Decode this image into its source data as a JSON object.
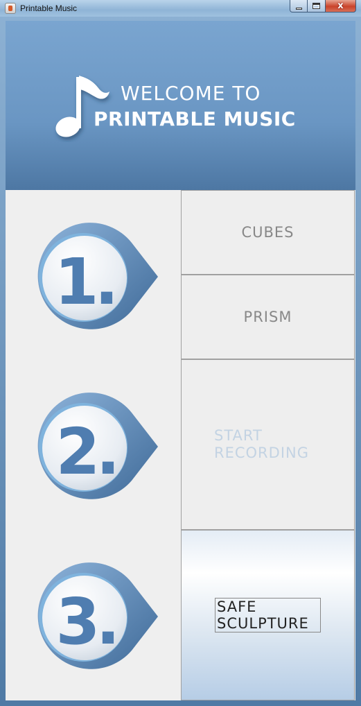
{
  "window": {
    "title": "Printable Music",
    "close_glyph": "x"
  },
  "banner": {
    "line1": "WELCOME TO",
    "line2": "PRINTABLE MUSIC",
    "logo_icon": "music-note-icon"
  },
  "steps": [
    {
      "number": "1.",
      "icon": "step-one-badge-icon"
    },
    {
      "number": "2.",
      "icon": "step-two-badge-icon"
    },
    {
      "number": "3.",
      "icon": "step-three-badge-icon"
    }
  ],
  "buttons": {
    "cubes": "CUBES",
    "prism": "PRISM",
    "start_recording": "START RECORDING",
    "safe_sculpture": "SAFE SCULPTURE"
  },
  "colors": {
    "accent": "#4f7db0",
    "disabled_text": "#c3d3e3",
    "button_text": "#888888"
  }
}
